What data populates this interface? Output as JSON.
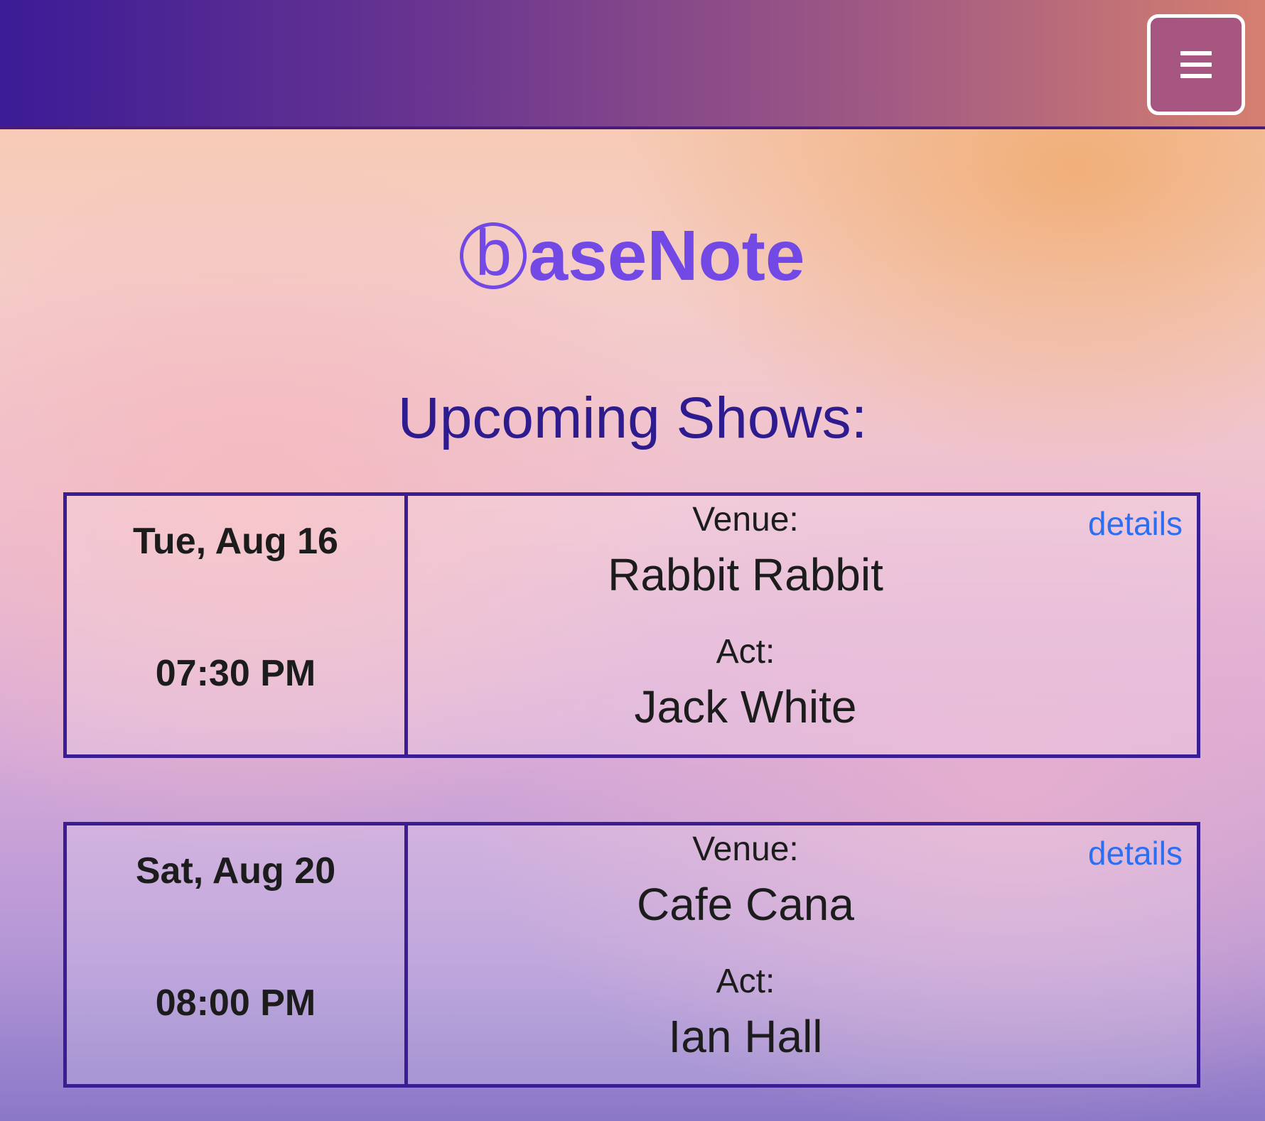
{
  "navbar": {
    "menu_icon": "hamburger-icon"
  },
  "logo": {
    "circled_letter": "b",
    "rest": "aseNote"
  },
  "heading": "Upcoming Shows:",
  "shows": [
    {
      "date": "Tue, Aug 16",
      "time": "07:30 PM",
      "venue_label": "Venue:",
      "venue": "Rabbit Rabbit",
      "act_label": "Act:",
      "act": "Jack White",
      "details_label": "details"
    },
    {
      "date": "Sat, Aug 20",
      "time": "08:00 PM",
      "venue_label": "Venue:",
      "venue": "Cafe Cana",
      "act_label": "Act:",
      "act": "Ian Hall",
      "details_label": "details"
    }
  ],
  "colors": {
    "brand": "#7349e6",
    "heading": "#2e1c8f",
    "card_border": "#3b1d93",
    "link": "#2d6ff0"
  }
}
